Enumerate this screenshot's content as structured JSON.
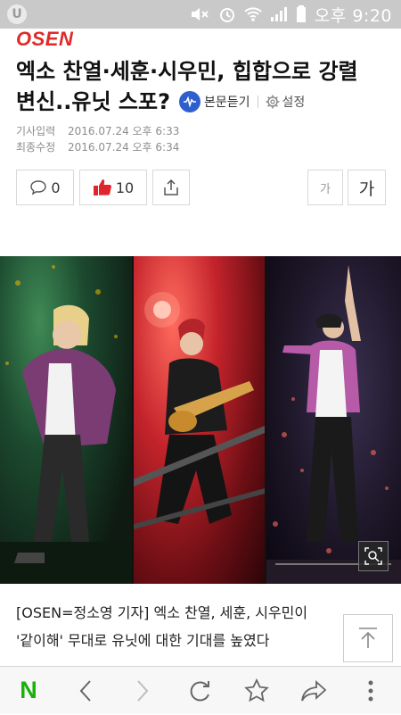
{
  "status_bar": {
    "ampm": "오후",
    "time": "9:20",
    "left_icon": "U"
  },
  "brand": {
    "logo_text": "OSEN",
    "color": "#e02a2a"
  },
  "title": {
    "line1": "엑소 찬열·세훈·시우민, 힙합으로 강렬",
    "line2": "변신..유닛 스포?"
  },
  "listen": {
    "label": "본문듣기",
    "icon": "audio-wave-icon"
  },
  "settings": {
    "label": "설정",
    "icon": "gear-icon"
  },
  "meta": {
    "published_label": "기사입력",
    "published_value": "2016.07.24 오후 6:33",
    "modified_label": "최종수정",
    "modified_value": "2016.07.24 오후 6:34"
  },
  "actions": {
    "comment_count": "0",
    "like_count": "10",
    "font_small_label": "가",
    "font_large_label": "가"
  },
  "article": {
    "line1": "[OSEN=정소영 기자] 엑소 찬열, 세훈, 시우민이",
    "line2": "'같이해' 무대로 유닛에 대한 기대를 높였다"
  },
  "bottom_nav": {
    "home_label": "N"
  },
  "colors": {
    "accent_green": "#19b10a",
    "like_red": "#e0262c",
    "listen_blue": "#2f5fcf"
  }
}
